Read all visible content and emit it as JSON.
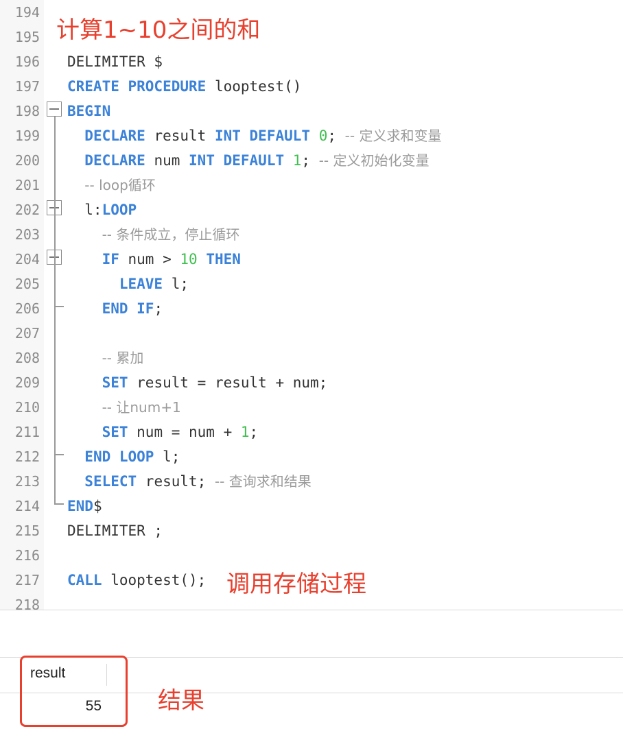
{
  "annotations": {
    "title": "计算1~10之间的和",
    "call_note": "调用存储过程",
    "result_note": "结果"
  },
  "lines": [
    {
      "n": "194",
      "tokens": []
    },
    {
      "n": "195",
      "tokens": []
    },
    {
      "n": "196",
      "tokens": [
        {
          "t": "DELIMITER $",
          "c": ""
        }
      ]
    },
    {
      "n": "197",
      "tokens": [
        {
          "t": "CREATE PROCEDURE",
          "c": "kw"
        },
        {
          "t": " looptest()",
          "c": ""
        }
      ]
    },
    {
      "n": "198",
      "tokens": [
        {
          "t": "BEGIN",
          "c": "kw"
        }
      ]
    },
    {
      "n": "199",
      "tokens": [
        {
          "t": "  ",
          "c": ""
        },
        {
          "t": "DECLARE",
          "c": "kw"
        },
        {
          "t": " result ",
          "c": ""
        },
        {
          "t": "INT DEFAULT",
          "c": "kw"
        },
        {
          "t": " ",
          "c": ""
        },
        {
          "t": "0",
          "c": "num"
        },
        {
          "t": "; ",
          "c": ""
        },
        {
          "t": "-- 定义求和变量",
          "c": "cmt"
        }
      ]
    },
    {
      "n": "200",
      "tokens": [
        {
          "t": "  ",
          "c": ""
        },
        {
          "t": "DECLARE",
          "c": "kw"
        },
        {
          "t": " num ",
          "c": ""
        },
        {
          "t": "INT DEFAULT",
          "c": "kw"
        },
        {
          "t": " ",
          "c": ""
        },
        {
          "t": "1",
          "c": "num"
        },
        {
          "t": "; ",
          "c": ""
        },
        {
          "t": "-- 定义初始化变量",
          "c": "cmt"
        }
      ]
    },
    {
      "n": "201",
      "tokens": [
        {
          "t": "  ",
          "c": ""
        },
        {
          "t": "-- loop循环",
          "c": "cmt"
        }
      ]
    },
    {
      "n": "202",
      "tokens": [
        {
          "t": "  l:",
          "c": ""
        },
        {
          "t": "LOOP",
          "c": "kw"
        }
      ]
    },
    {
      "n": "203",
      "tokens": [
        {
          "t": "    ",
          "c": ""
        },
        {
          "t": "-- 条件成立，停止循环",
          "c": "cmt"
        }
      ]
    },
    {
      "n": "204",
      "tokens": [
        {
          "t": "    ",
          "c": ""
        },
        {
          "t": "IF",
          "c": "kw"
        },
        {
          "t": " num > ",
          "c": ""
        },
        {
          "t": "10",
          "c": "num"
        },
        {
          "t": " ",
          "c": ""
        },
        {
          "t": "THEN",
          "c": "kw"
        }
      ]
    },
    {
      "n": "205",
      "tokens": [
        {
          "t": "      ",
          "c": ""
        },
        {
          "t": "LEAVE",
          "c": "kw"
        },
        {
          "t": " l;",
          "c": ""
        }
      ]
    },
    {
      "n": "206",
      "tokens": [
        {
          "t": "    ",
          "c": ""
        },
        {
          "t": "END IF",
          "c": "kw"
        },
        {
          "t": ";",
          "c": ""
        }
      ]
    },
    {
      "n": "207",
      "tokens": []
    },
    {
      "n": "208",
      "tokens": [
        {
          "t": "    ",
          "c": ""
        },
        {
          "t": "-- 累加",
          "c": "cmt"
        }
      ]
    },
    {
      "n": "209",
      "tokens": [
        {
          "t": "    ",
          "c": ""
        },
        {
          "t": "SET",
          "c": "kw"
        },
        {
          "t": " result = result + num;",
          "c": ""
        }
      ]
    },
    {
      "n": "210",
      "tokens": [
        {
          "t": "    ",
          "c": ""
        },
        {
          "t": "-- 让num+1",
          "c": "cmt"
        }
      ]
    },
    {
      "n": "211",
      "tokens": [
        {
          "t": "    ",
          "c": ""
        },
        {
          "t": "SET",
          "c": "kw"
        },
        {
          "t": " num = num + ",
          "c": ""
        },
        {
          "t": "1",
          "c": "num"
        },
        {
          "t": ";",
          "c": ""
        }
      ]
    },
    {
      "n": "212",
      "tokens": [
        {
          "t": "  ",
          "c": ""
        },
        {
          "t": "END LOOP",
          "c": "kw"
        },
        {
          "t": " l;",
          "c": ""
        }
      ]
    },
    {
      "n": "213",
      "tokens": [
        {
          "t": "  ",
          "c": ""
        },
        {
          "t": "SELECT",
          "c": "kw"
        },
        {
          "t": " result; ",
          "c": ""
        },
        {
          "t": "-- 查询求和结果",
          "c": "cmt"
        }
      ]
    },
    {
      "n": "214",
      "tokens": [
        {
          "t": "END",
          "c": "kw"
        },
        {
          "t": "$",
          "c": ""
        }
      ]
    },
    {
      "n": "215",
      "tokens": [
        {
          "t": "DELIMITER ;",
          "c": ""
        }
      ]
    },
    {
      "n": "216",
      "tokens": []
    },
    {
      "n": "217",
      "tokens": [
        {
          "t": "CALL",
          "c": "kw"
        },
        {
          "t": " looptest();",
          "c": ""
        }
      ]
    },
    {
      "n": "218",
      "tokens": []
    }
  ],
  "result_grid": {
    "column": "result",
    "value": "55"
  },
  "colors": {
    "keyword": "#3b82d8",
    "number": "#3fbf4f",
    "comment": "#9b9b9b",
    "annotation": "#e8402e"
  }
}
